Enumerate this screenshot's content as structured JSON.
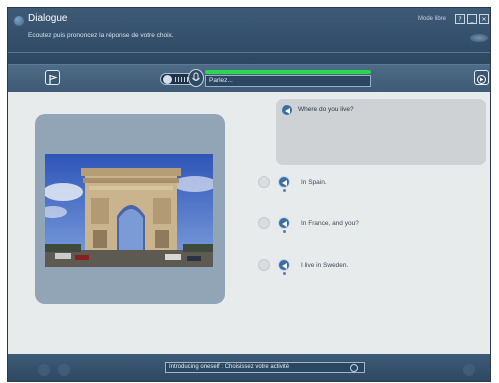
{
  "header": {
    "title": "Dialogue",
    "subtitle": "Ecoutez puis prononcez la réponse de votre choix.",
    "mode_label": "Mode libre",
    "help_icon": "help-icon",
    "minimize_icon": "minimize-icon",
    "close_icon": "close-icon",
    "help_glyph": "?",
    "minimize_glyph": "_",
    "close_glyph": "×"
  },
  "toolbar": {
    "status_text": "Parlez...",
    "progress": 1.0,
    "progress_color": "#2cd64f"
  },
  "dialogue": {
    "question": "Where do you live?",
    "answers": [
      {
        "text": "In Spain."
      },
      {
        "text": "In France, and you?"
      },
      {
        "text": "I live in Sweden."
      }
    ]
  },
  "footer": {
    "activity_text": "Introducing oneself : Choisissez votre activité"
  },
  "colors": {
    "accent": "#3a6ea5",
    "header_bg": "#2d4762",
    "panel_bg": "#e8ebec"
  }
}
